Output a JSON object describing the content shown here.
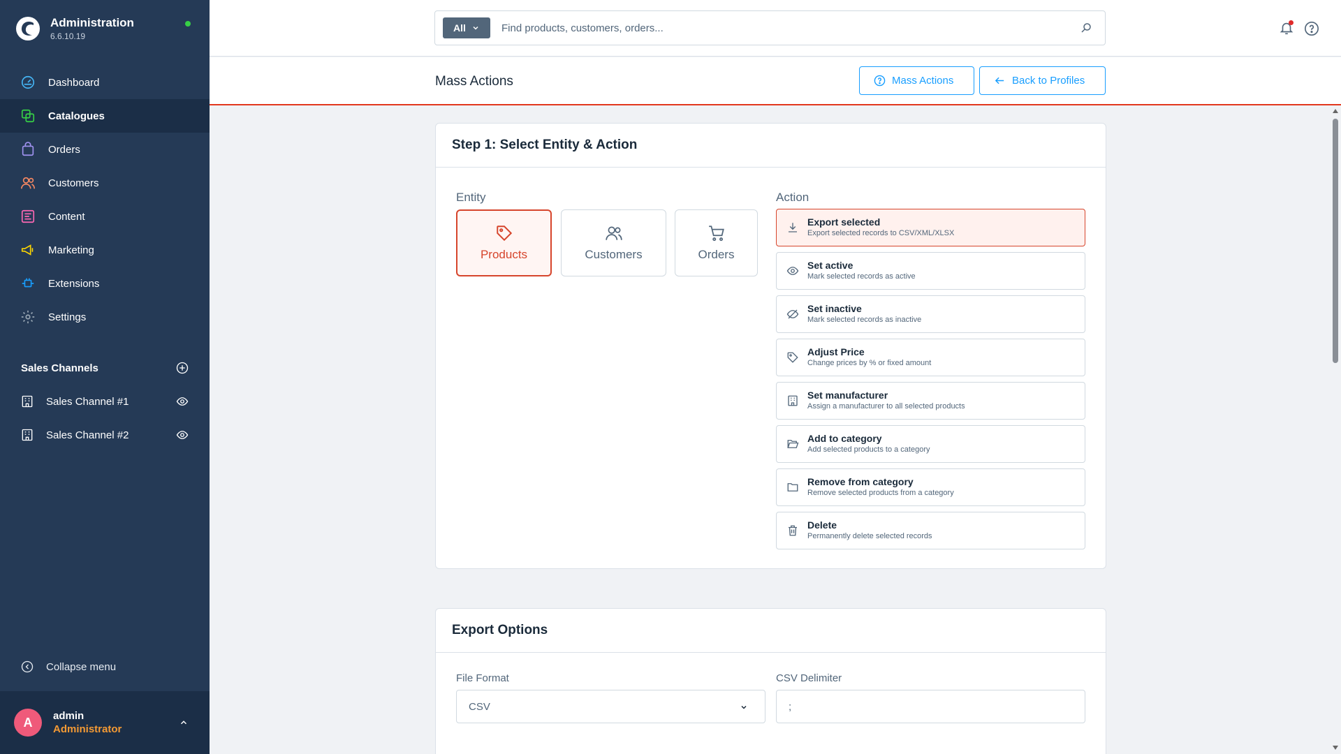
{
  "app": {
    "title": "Administration",
    "version": "6.6.10.19"
  },
  "nav": [
    {
      "label": "Dashboard",
      "icon": "gauge-icon",
      "color": "#45b5f5"
    },
    {
      "label": "Catalogues",
      "icon": "catalogue-icon",
      "color": "#37d046"
    },
    {
      "label": "Orders",
      "icon": "bag-icon",
      "color": "#a092f0"
    },
    {
      "label": "Customers",
      "icon": "users-icon",
      "color": "#f88962"
    },
    {
      "label": "Content",
      "icon": "content-icon",
      "color": "#ff68b4"
    },
    {
      "label": "Marketing",
      "icon": "megaphone-icon",
      "color": "#ffd700"
    },
    {
      "label": "Extensions",
      "icon": "plug-icon",
      "color": "#189eff"
    },
    {
      "label": "Settings",
      "icon": "gear-icon",
      "color": "#9aa8b5"
    }
  ],
  "sales_channels": {
    "title": "Sales Channels",
    "items": [
      {
        "label": "Sales Channel #1"
      },
      {
        "label": "Sales Channel #2"
      }
    ]
  },
  "collapse_label": "Collapse menu",
  "user": {
    "initial": "A",
    "name": "admin",
    "role": "Administrator"
  },
  "search": {
    "scope": "All",
    "placeholder": "Find products, customers, orders..."
  },
  "page": {
    "title": "Mass Actions",
    "help_button": "Mass Actions",
    "back_button": "Back to Profiles"
  },
  "step1": {
    "title": "Step 1: Select Entity & Action",
    "entity_label": "Entity",
    "action_label": "Action",
    "entities": [
      {
        "label": "Products",
        "icon": "tag-icon"
      },
      {
        "label": "Customers",
        "icon": "users-icon"
      },
      {
        "label": "Orders",
        "icon": "cart-icon"
      }
    ],
    "selected_entity": "Products",
    "actions": [
      {
        "title": "Export selected",
        "desc": "Export selected records to CSV/XML/XLSX",
        "icon": "download-icon"
      },
      {
        "title": "Set active",
        "desc": "Mark selected records as active",
        "icon": "eye-icon"
      },
      {
        "title": "Set inactive",
        "desc": "Mark selected records as inactive",
        "icon": "eye-off-icon"
      },
      {
        "title": "Adjust Price",
        "desc": "Change prices by % or fixed amount",
        "icon": "tag-icon"
      },
      {
        "title": "Set manufacturer",
        "desc": "Assign a manufacturer to all selected products",
        "icon": "building-icon"
      },
      {
        "title": "Add to category",
        "desc": "Add selected products to a category",
        "icon": "folder-open-icon"
      },
      {
        "title": "Remove from category",
        "desc": "Remove selected products from a category",
        "icon": "folder-icon"
      },
      {
        "title": "Delete",
        "desc": "Permanently delete selected records",
        "icon": "trash-icon"
      }
    ],
    "selected_action": "Export selected"
  },
  "export": {
    "title": "Export Options",
    "file_format_label": "File Format",
    "file_format_value": "CSV",
    "delimiter_label": "CSV Delimiter",
    "delimiter_value": ";"
  },
  "colors": {
    "sidebar": "#253a56",
    "accent": "#189eff",
    "selected": "#d6452c"
  }
}
